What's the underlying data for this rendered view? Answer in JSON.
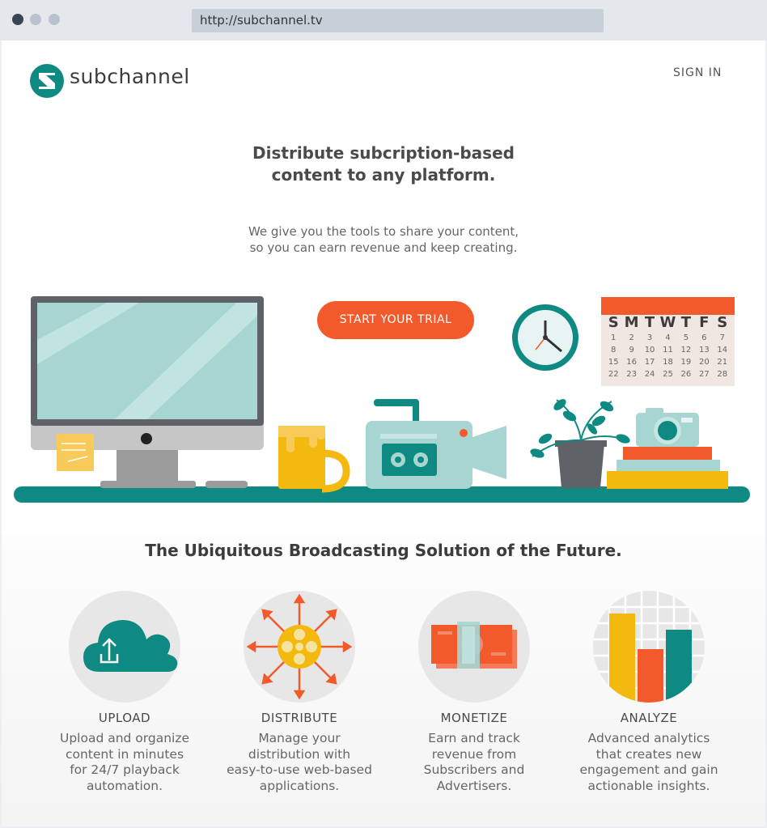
{
  "browser": {
    "url": "http://subchannel.tv"
  },
  "header": {
    "brand": "subchannel",
    "sign_in": "SIGN IN"
  },
  "hero": {
    "headline_line1": "Distribute subcription-based",
    "headline_line2": "content to any platform.",
    "sub_line1": "We give you the tools to share your content,",
    "sub_line2": "so you can earn revenue and keep creating.",
    "cta": "START YOUR TRIAL"
  },
  "calendar": {
    "days": [
      "S",
      "M",
      "T",
      "W",
      "T",
      "F",
      "S"
    ],
    "dates": [
      "1",
      "2",
      "3",
      "4",
      "5",
      "6",
      "7",
      "8",
      "9",
      "10",
      "11",
      "12",
      "13",
      "14",
      "15",
      "16",
      "17",
      "18",
      "19",
      "20",
      "21",
      "22",
      "23",
      "24",
      "25",
      "26",
      "27",
      "28"
    ]
  },
  "features": {
    "title": "The Ubiquitous Broadcasting Solution of the Future.",
    "items": [
      {
        "title": "UPLOAD",
        "desc1": "Upload and organize",
        "desc2": "content in minutes",
        "desc3": "for 24/7 playback",
        "desc4": "automation.",
        "icon": "cloud-upload-icon"
      },
      {
        "title": "DISTRIBUTE",
        "desc1": "Manage your",
        "desc2": "distribution with",
        "desc3": "easy-to-use web-based",
        "desc4": "applications.",
        "icon": "film-reel-icon"
      },
      {
        "title": "MONETIZE",
        "desc1": "Earn and track",
        "desc2": "revenue from",
        "desc3": "Subscribers and",
        "desc4": "Advertisers.",
        "icon": "money-icon"
      },
      {
        "title": "ANALYZE",
        "desc1": "Advanced analytics",
        "desc2": "that creates new",
        "desc3": "engagement and gain",
        "desc4": "actionable insights.",
        "icon": "bar-chart-icon"
      }
    ]
  },
  "colors": {
    "teal": "#0e8a83",
    "orange": "#f25a2c",
    "yellow": "#f3b90f",
    "mint": "#a6d5d2"
  }
}
